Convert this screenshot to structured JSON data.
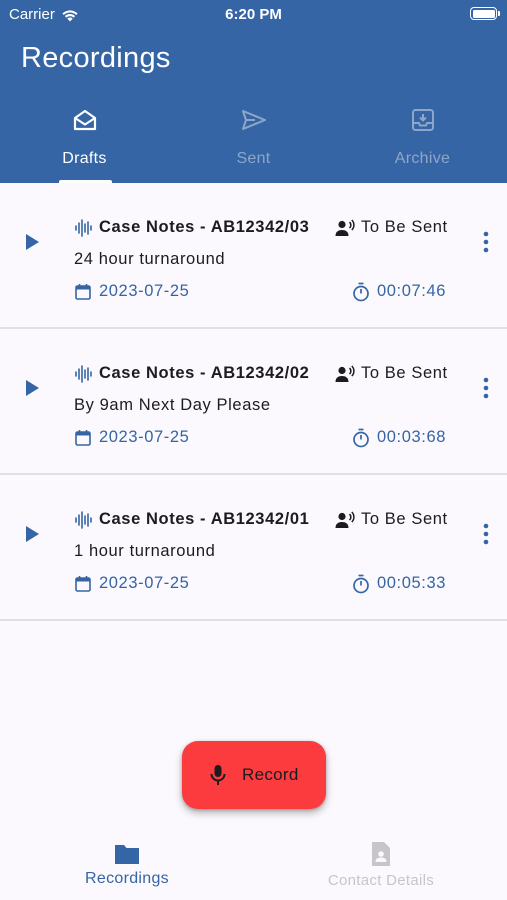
{
  "status_bar": {
    "carrier": "Carrier",
    "time": "6:20 PM",
    "icons": [
      "wifi-icon",
      "battery-icon"
    ]
  },
  "header": {
    "title": "Recordings",
    "background": "#3565a5"
  },
  "tabs": [
    {
      "label": "Drafts",
      "icon": "envelope-open-icon",
      "active": true
    },
    {
      "label": "Sent",
      "icon": "send-icon",
      "active": false
    },
    {
      "label": "Archive",
      "icon": "archive-icon",
      "active": false
    }
  ],
  "recordings": [
    {
      "title": "Case Notes - AB12342/03",
      "status": "To Be Sent",
      "note": "24 hour turnaround",
      "date": "2023-07-25",
      "duration": "00:07:46"
    },
    {
      "title": "Case Notes - AB12342/02",
      "status": "To Be Sent",
      "note": "By 9am Next Day Please",
      "date": "2023-07-25",
      "duration": "00:03:68"
    },
    {
      "title": "Case Notes - AB12342/01",
      "status": "To Be Sent",
      "note": "1 hour turnaround",
      "date": "2023-07-25",
      "duration": "00:05:33"
    }
  ],
  "fab": {
    "label": "Record",
    "icon": "microphone-icon",
    "color": "#fb3b3d"
  },
  "bottom_nav": [
    {
      "label": "Recordings",
      "icon": "folder-icon",
      "active": true
    },
    {
      "label": "Contact Details",
      "icon": "contact-file-icon",
      "active": false
    }
  ],
  "colors": {
    "accent": "#3565a5",
    "background": "#fbf9fd",
    "divider": "#e1dfe4"
  }
}
